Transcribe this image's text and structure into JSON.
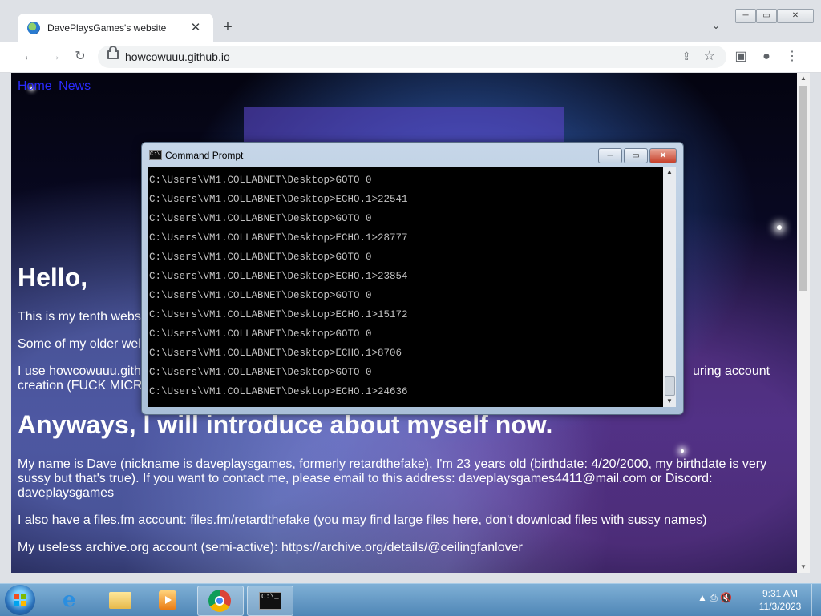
{
  "browser": {
    "tab_title": "DavePlaysGames's website",
    "tab_close": "✕",
    "new_tab": "+",
    "tab_list": "⌄",
    "url": "howcowuuu.github.io",
    "nav_back": "←",
    "nav_forward": "→",
    "reload": "↻",
    "share": "⇪",
    "bookmark": "☆",
    "side_panel": "▣",
    "profile": "●",
    "menu": "⋮",
    "win_min": "─",
    "win_max": "▭",
    "win_close": "✕"
  },
  "page": {
    "nav": [
      "Home",
      "News"
    ],
    "hello": "Hello,",
    "p1": "This is my tenth webs",
    "p2": "Some of my older wel",
    "p3_left": "I use howcowuuu.gith",
    "p3_right": "uring account",
    "p3_line2": "creation (FUCK MICR",
    "h_intro": "Anyways, I will introduce about myself now.",
    "about": "My name is Dave (nickname is daveplaysgames, formerly retardthefake), I'm 23 years old (birthdate: 4/20/2000, my birthdate is very sussy but that's true). If you want to contact me, please email to this address: daveplaysgames4411@mail.com or Discord: daveplaysgames",
    "files": "I also have a files.fm account: files.fm/retardthefake (you may find large files here, don't download files with sussy names)",
    "archive": "My useless archive.org account (semi-active): https://archive.org/details/@ceilingfanlover"
  },
  "cmd": {
    "title": "Command Prompt",
    "min": "─",
    "max": "▭",
    "close": "✕",
    "lines": [
      "C:\\Users\\VM1.COLLABNET\\Desktop>GOTO 0",
      "C:\\Users\\VM1.COLLABNET\\Desktop>ECHO.1>22541",
      "C:\\Users\\VM1.COLLABNET\\Desktop>GOTO 0",
      "C:\\Users\\VM1.COLLABNET\\Desktop>ECHO.1>28777",
      "C:\\Users\\VM1.COLLABNET\\Desktop>GOTO 0",
      "C:\\Users\\VM1.COLLABNET\\Desktop>ECHO.1>23854",
      "C:\\Users\\VM1.COLLABNET\\Desktop>GOTO 0",
      "C:\\Users\\VM1.COLLABNET\\Desktop>ECHO.1>15172",
      "C:\\Users\\VM1.COLLABNET\\Desktop>GOTO 0",
      "C:\\Users\\VM1.COLLABNET\\Desktop>ECHO.1>8706",
      "C:\\Users\\VM1.COLLABNET\\Desktop>GOTO 0",
      "C:\\Users\\VM1.COLLABNET\\Desktop>ECHO.1>24636"
    ]
  },
  "taskbar": {
    "tray_icons": "▲ ⎙ 🔇",
    "time": "9:31 AM",
    "date": "11/3/2023",
    "items": [
      "internet-explorer",
      "windows-explorer",
      "media-player",
      "google-chrome",
      "command-prompt"
    ]
  }
}
